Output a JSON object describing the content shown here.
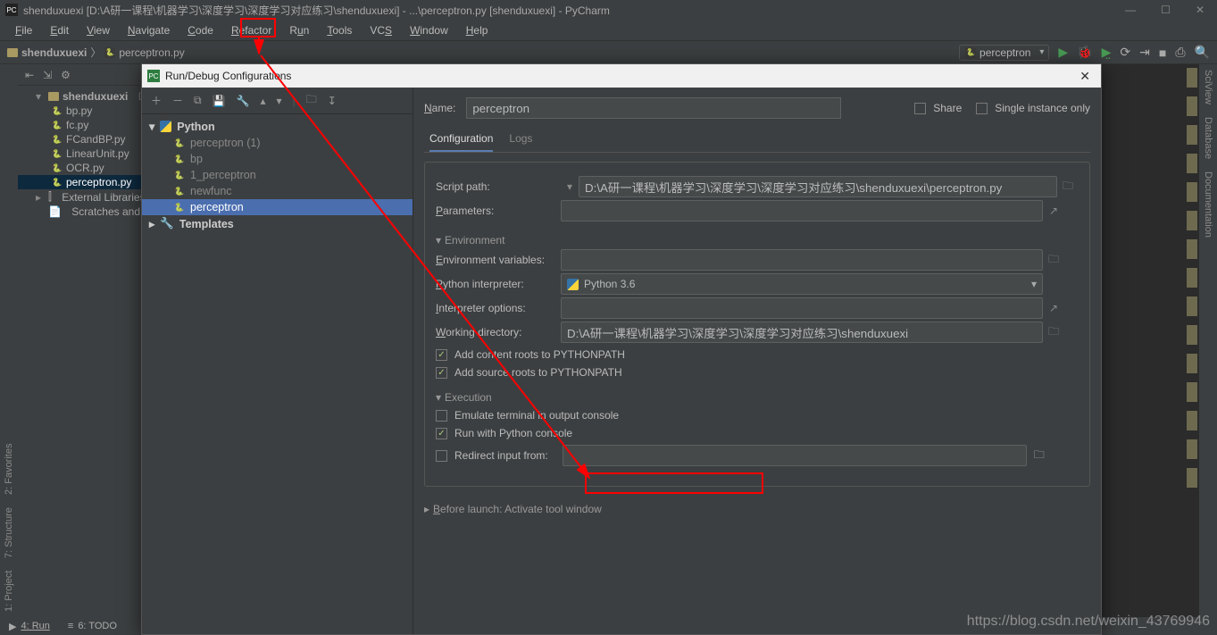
{
  "title": "shenduxuexi [D:\\A研一课程\\机器学习\\深度学习\\深度学习对应练习\\shenduxuexi] - ...\\perceptron.py [shenduxuexi] - PyCharm",
  "menu": {
    "file": "File",
    "edit": "Edit",
    "view": "View",
    "navigate": "Navigate",
    "code": "Code",
    "refactor": "Refactor",
    "run": "Run",
    "tools": "Tools",
    "vcs": "VCS",
    "window": "Window",
    "help": "Help"
  },
  "breadcrumb": {
    "root": "shenduxuexi",
    "file": "perceptron.py"
  },
  "runcfg_selected": "perceptron",
  "left_tabs": {
    "project": "1: Project",
    "structure": "7: Structure",
    "favorites": "2: Favorites"
  },
  "right_tabs": {
    "sciview": "SciView",
    "database": "Database",
    "documentation": "Documentation"
  },
  "projectTree": {
    "root": "shenduxuexi",
    "root_suffix": "D:",
    "files": [
      "bp.py",
      "fc.py",
      "FCandBP.py",
      "LinearUnit.py",
      "OCR.py",
      "perceptron.py"
    ],
    "extlib": "External Libraries",
    "scratches": "Scratches and Co"
  },
  "statusbar": {
    "run": "4: Run",
    "todo": "6: TODO"
  },
  "dialog": {
    "title": "Run/Debug Configurations",
    "tree": {
      "python": "Python",
      "items": [
        "perceptron (1)",
        "bp",
        "1_perceptron",
        "newfunc",
        "perceptron"
      ],
      "templates": "Templates"
    },
    "name_label": "Name:",
    "name_value": "perceptron",
    "share": "Share",
    "single": "Single instance only",
    "tabs": {
      "conf": "Configuration",
      "logs": "Logs"
    },
    "fields": {
      "script_path": {
        "label": "Script path:",
        "value": "D:\\A研一课程\\机器学习\\深度学习\\深度学习对应练习\\shenduxuexi\\perceptron.py"
      },
      "parameters": {
        "label": "Parameters:",
        "value": ""
      },
      "env_header": "Environment",
      "env_vars": {
        "label": "Environment variables:",
        "value": ""
      },
      "interpreter": {
        "label": "Python interpreter:",
        "value": "Python 3.6"
      },
      "interp_opts": {
        "label": "Interpreter options:",
        "value": ""
      },
      "workdir": {
        "label": "Working directory:",
        "value": "D:\\A研一课程\\机器学习\\深度学习\\深度学习对应练习\\shenduxuexi"
      },
      "add_content": "Add content roots to PYTHONPATH",
      "add_source": "Add source roots to PYTHONPATH",
      "exec_header": "Execution",
      "emulate": "Emulate terminal in output console",
      "pyconsole": "Run with Python console",
      "redirect": "Redirect input from:",
      "before": "Before launch: Activate tool window"
    }
  },
  "watermark": "https://blog.csdn.net/weixin_43769946"
}
